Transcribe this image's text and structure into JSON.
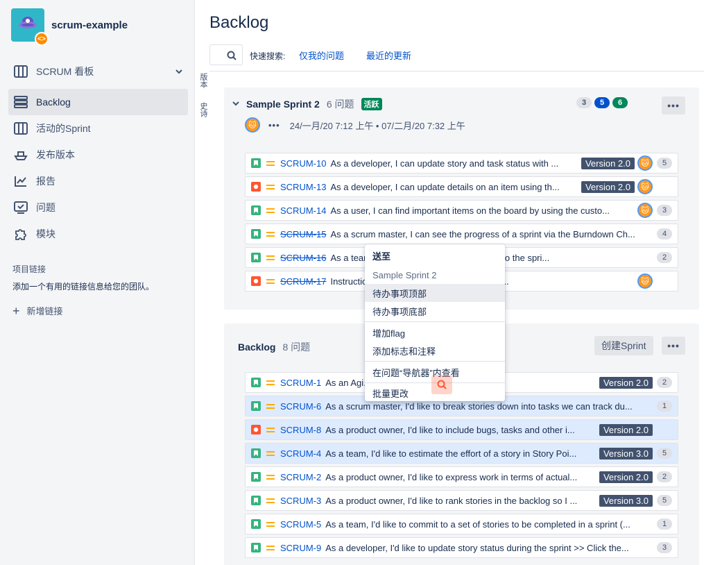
{
  "project": {
    "name": "scrum-example",
    "badge": "<>"
  },
  "nav": {
    "board": "SCRUM 看板",
    "backlog": "Backlog",
    "active_sprint": "活动的Sprint",
    "releases": "发布版本",
    "reports": "报告",
    "issues": "问题",
    "components": "模块"
  },
  "project_links": {
    "title": "项目链接",
    "desc": "添加一个有用的链接信息给您的团队。",
    "add": "新增链接"
  },
  "header": {
    "title": "Backlog",
    "quick_search_label": "快速搜索:",
    "quick_filters": [
      "仅我的问题",
      "最近的更新"
    ],
    "side_tabs": [
      "版本",
      "史诗"
    ]
  },
  "sprint": {
    "name": "Sample Sprint 2",
    "count": "6 问题",
    "status": "活跃",
    "pill_todo": "3",
    "pill_progress": "5",
    "pill_done": "6",
    "more": "•••",
    "dates": "24/一月/20 7:12 上午 • 07/二月/20 7:32 上午",
    "issues": [
      {
        "type": "story",
        "key": "SCRUM-10",
        "done": false,
        "summary": "As a developer, I can update story and task status with ...",
        "version": "Version 2.0",
        "avatar": true,
        "points": "5"
      },
      {
        "type": "bug",
        "key": "SCRUM-13",
        "done": false,
        "summary": "As a developer, I can update details on an item using th...",
        "version": "Version 2.0",
        "avatar": true,
        "points": ""
      },
      {
        "type": "story",
        "key": "SCRUM-14",
        "done": false,
        "summary": "As a user, I can find important items on the board by using the custo...",
        "version": "",
        "avatar": true,
        "points": "3"
      },
      {
        "type": "story",
        "key": "SCRUM-15",
        "done": true,
        "summary": "As a scrum master, I can see the progress of a sprint via the Burndown Ch...",
        "version": "",
        "avatar": false,
        "points": "4"
      },
      {
        "type": "story",
        "key": "SCRUM-16",
        "done": true,
        "summary": "As a team, I can ... cking the cog icon next to the spri...",
        "version": "",
        "avatar": false,
        "points": "2"
      },
      {
        "type": "bug",
        "key": "SCRUM-17",
        "done": true,
        "summary": "Instructions ... rd and project are in the des...",
        "version": "",
        "avatar": true,
        "points": ""
      }
    ]
  },
  "backlog": {
    "name": "Backlog",
    "count": "8 问题",
    "create_sprint": "创建Sprint",
    "more": "•••",
    "issues": [
      {
        "type": "story",
        "key": "SCRUM-1",
        "done": false,
        "selected": false,
        "summary": "As an Agi... rum >> Click the \"...",
        "version": "Version 2.0",
        "points": "2"
      },
      {
        "type": "story",
        "key": "SCRUM-6",
        "done": false,
        "selected": true,
        "summary": "As a scrum master, I'd like to break stories down into tasks we can track du...",
        "version": "",
        "points": "1"
      },
      {
        "type": "bug",
        "key": "SCRUM-8",
        "done": false,
        "selected": true,
        "summary": "As a product owner, I'd like to include bugs, tasks and other i...",
        "version": "Version 2.0",
        "points": ""
      },
      {
        "type": "story",
        "key": "SCRUM-4",
        "done": false,
        "selected": true,
        "summary": "As a team, I'd like to estimate the effort of a story in Story Poi...",
        "version": "Version 3.0",
        "points": "5"
      },
      {
        "type": "story",
        "key": "SCRUM-2",
        "done": false,
        "selected": false,
        "summary": "As a product owner, I'd like to express work in terms of actual...",
        "version": "Version 2.0",
        "points": "2"
      },
      {
        "type": "story",
        "key": "SCRUM-3",
        "done": false,
        "selected": false,
        "summary": "As a product owner, I'd like to rank stories in the backlog so I ...",
        "version": "Version 3.0",
        "points": "5"
      },
      {
        "type": "story",
        "key": "SCRUM-5",
        "done": false,
        "selected": false,
        "summary": "As a team, I'd like to commit to a set of stories to be completed in a sprint (...",
        "version": "",
        "points": "1"
      },
      {
        "type": "story",
        "key": "SCRUM-9",
        "done": false,
        "selected": false,
        "summary": "As a developer, I'd like to update story status during the sprint >> Click the...",
        "version": "",
        "points": "3"
      }
    ]
  },
  "context_menu": {
    "send_to": "送至",
    "sprint": "Sample Sprint 2",
    "top": "待办事项顶部",
    "bottom": "待办事项底部",
    "add_flag": "增加flag",
    "add_flag_comment": "添加标志和注释",
    "view_navigator": "在问题“导航器”内查看",
    "bulk_change": "批量更改"
  },
  "colors": {
    "story": "#36b37e",
    "bug": "#ff5630",
    "link": "#0052cc",
    "version": "#42526e",
    "active": "#00875a"
  }
}
